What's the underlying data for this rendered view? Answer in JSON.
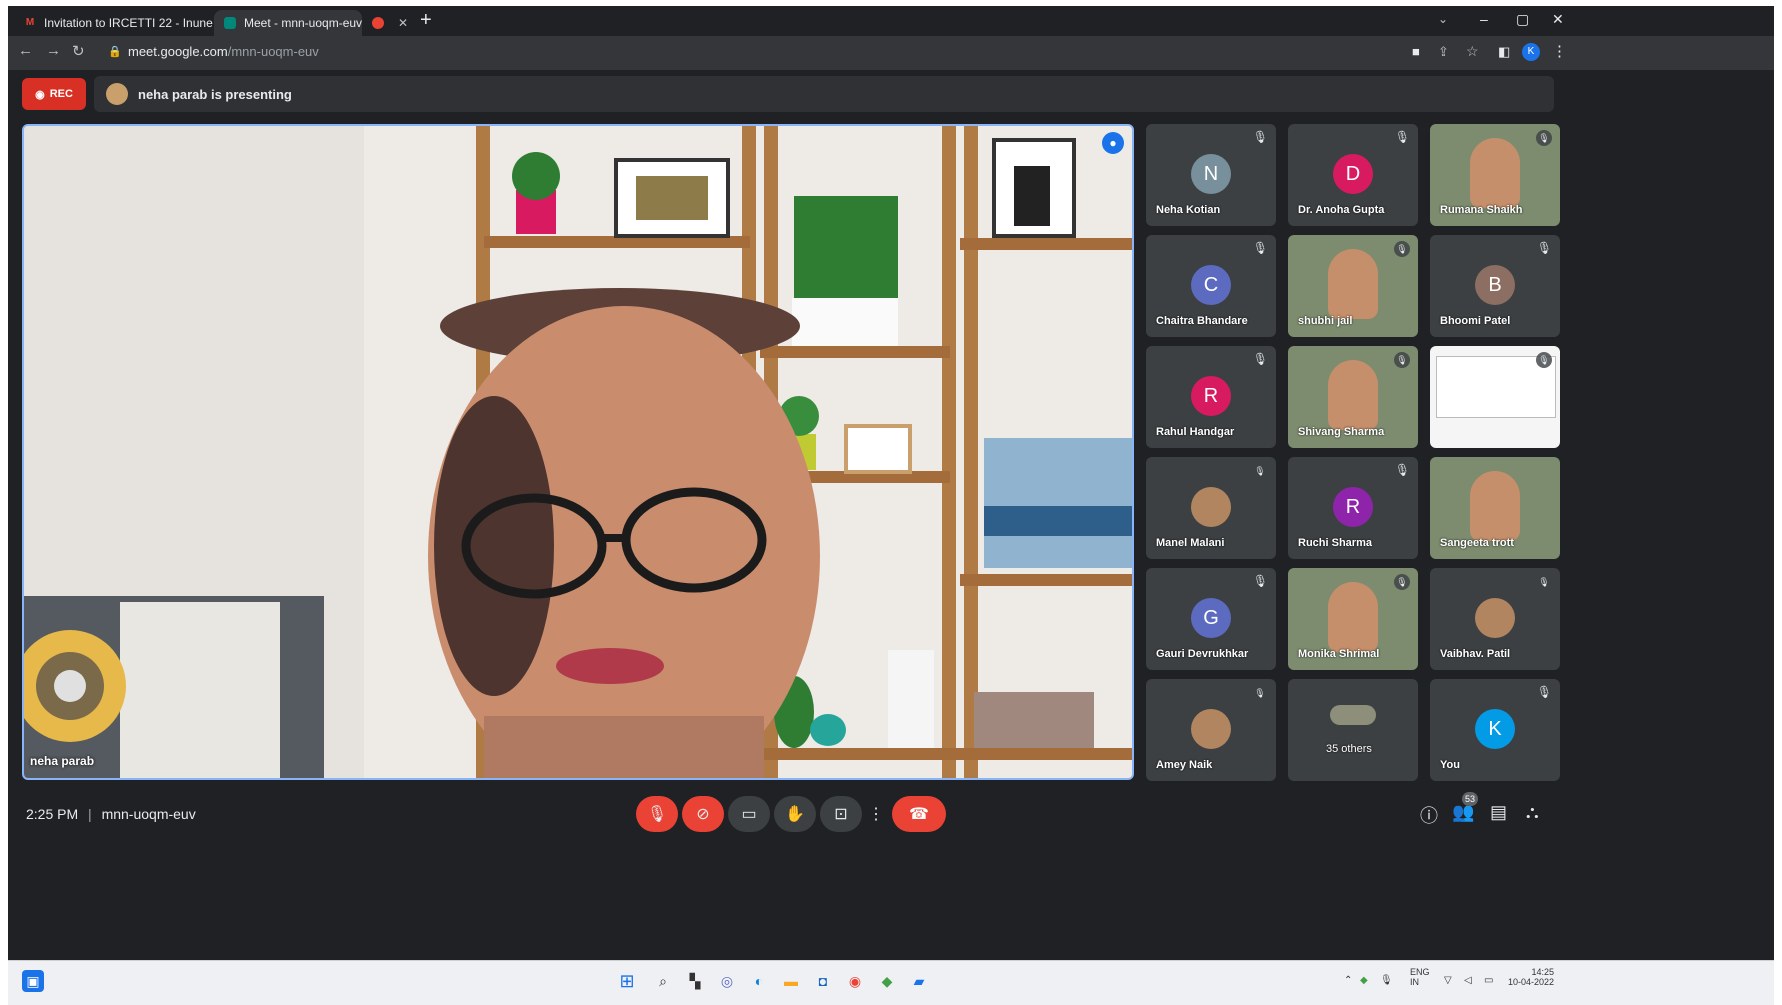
{
  "browser": {
    "tabs": [
      {
        "label": "Invitation to IRCETTI 22 - Inune",
        "icon": "gmail-icon"
      },
      {
        "label": "Meet - mnn-uoqm-euv",
        "icon": "meet-icon"
      },
      {
        "label": "",
        "icon": "recording-tab-icon"
      }
    ],
    "new_tab": "+",
    "url_host": "meet.google.com",
    "url_path": "/mnn-uoqm-euv",
    "window_controls": {
      "minimize": "–",
      "maximize": "▢",
      "close": "✕"
    }
  },
  "meet": {
    "rec_label": "REC",
    "presenting_text": "neha parab is presenting",
    "main_speaker_name": "neha parab",
    "time": "2:25 PM",
    "separator": "|",
    "meeting_code": "mnn-uoqm-euv",
    "participants": [
      {
        "name": "Neha Kotian",
        "initial": "N",
        "color": "#78909c",
        "muted": true
      },
      {
        "name": "Dr. Anoha Gupta",
        "initial": "D",
        "color": "#d81b60",
        "muted": true
      },
      {
        "name": "Rumana Shaikh",
        "photo": true,
        "muted": true
      },
      {
        "name": "Chaitra Bhandare",
        "initial": "C",
        "color": "#5c6bc0",
        "muted": true
      },
      {
        "name": "shubhi jail",
        "photo": true,
        "muted": true
      },
      {
        "name": "Bhoomi Patel",
        "initial": "B",
        "color": "#8d6e63",
        "muted": true
      },
      {
        "name": "Rahul Handgar",
        "initial": "R",
        "color": "#d81b60",
        "muted": true
      },
      {
        "name": "Shivang Sharma",
        "photo": true,
        "muted": true
      },
      {
        "name": "",
        "photo": true,
        "screen": true,
        "muted": true
      },
      {
        "name": "Manel Malani",
        "avatar": true,
        "muted": true
      },
      {
        "name": "Ruchi Sharma",
        "initial": "R",
        "color": "#8e24aa",
        "muted": true
      },
      {
        "name": "Sangeeta trott",
        "photo": true,
        "muted": false
      },
      {
        "name": "Gauri Devrukhkar",
        "initial": "G",
        "color": "#5c6bc0",
        "muted": true
      },
      {
        "name": "Monika Shrimal",
        "photo": true,
        "muted": true
      },
      {
        "name": "Vaibhav. Patil",
        "avatar": true,
        "muted": true
      },
      {
        "name": "Amey Naik",
        "avatar": true,
        "muted": true
      },
      {
        "name": "35 others",
        "others": true,
        "muted": false
      },
      {
        "name": "You",
        "initial": "K",
        "color": "#039be5",
        "muted": true
      }
    ],
    "people_count": "53"
  },
  "taskbar": {
    "lang_top": "ENG",
    "lang_bottom": "IN",
    "clock_time": "14:25",
    "clock_date": "10-04-2022"
  }
}
